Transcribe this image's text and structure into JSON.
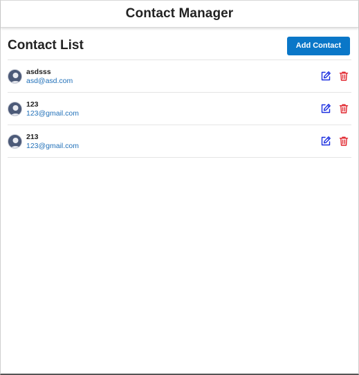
{
  "app": {
    "title": "Contact Manager"
  },
  "list": {
    "title": "Contact List",
    "add_button_label": "Add Contact"
  },
  "contacts": [
    {
      "name": "asdsss",
      "email": "asd@asd.com"
    },
    {
      "name": "123",
      "email": "123@gmail.com"
    },
    {
      "name": "213",
      "email": "123@gmail.com"
    }
  ],
  "colors": {
    "accent": "#0a77c8",
    "email_link": "#1f6fb8",
    "edit_icon": "#1a2ee0",
    "delete_icon": "#e0242c",
    "avatar_bg": "#4c5a78"
  },
  "icons": {
    "avatar": "user-avatar-icon",
    "edit": "edit-pencil-square-icon",
    "delete": "trash-icon"
  }
}
